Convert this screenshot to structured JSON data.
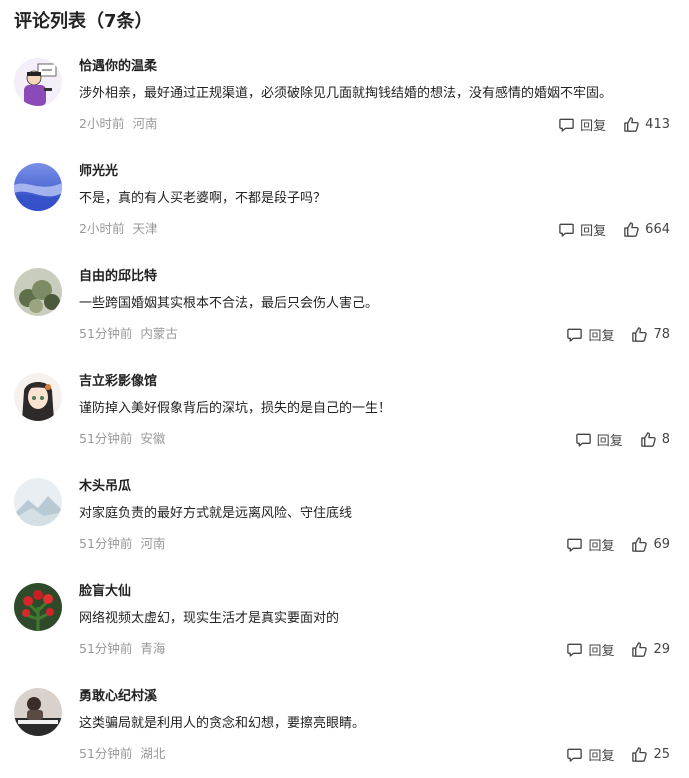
{
  "page_title": "评论列表（7条）",
  "reply_label": "回复",
  "comments": [
    {
      "username": "恰遇你的温柔",
      "content": "涉外相亲，最好通过正规渠道，必须破除见几面就掏钱结婚的想法，没有感情的婚姻不牢固。",
      "time": "2小时前",
      "location": "河南",
      "likes": "413"
    },
    {
      "username": "师光光",
      "content": "不是，真的有人买老婆啊，不都是段子吗？",
      "time": "2小时前",
      "location": "天津",
      "likes": "664"
    },
    {
      "username": "自由的邱比特",
      "content": "一些跨国婚姻其实根本不合法，最后只会伤人害己。",
      "time": "51分钟前",
      "location": "内蒙古",
      "likes": "78"
    },
    {
      "username": "吉立彩影像馆",
      "content": "谨防掉入美好假象背后的深坑，损失的是自己的一生！",
      "time": "51分钟前",
      "location": "安徽",
      "likes": "8"
    },
    {
      "username": "木头吊瓜",
      "content": "对家庭负责的最好方式就是远离风险、守住底线",
      "time": "51分钟前",
      "location": "河南",
      "likes": "69"
    },
    {
      "username": "脸盲大仙",
      "content": "网络视频太虚幻，现实生活才是真实要面对的",
      "time": "51分钟前",
      "location": "青海",
      "likes": "29"
    },
    {
      "username": "勇敢心纪村溪",
      "content": "这类骗局就是利用人的贪念和幻想，要擦亮眼睛。",
      "time": "51分钟前",
      "location": "湖北",
      "likes": "25"
    }
  ]
}
